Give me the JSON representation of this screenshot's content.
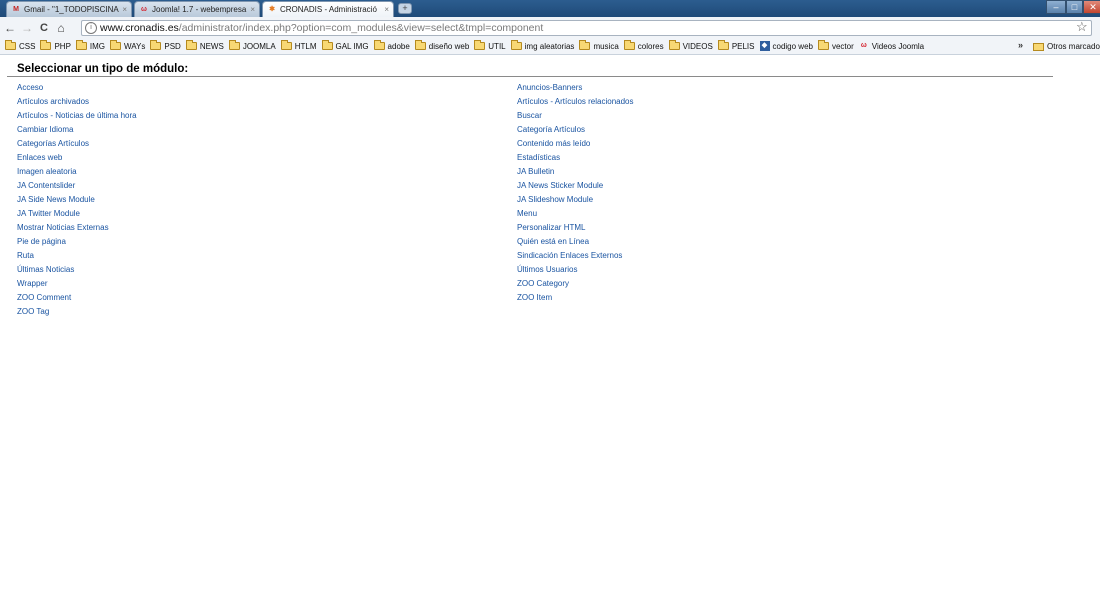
{
  "browser": {
    "tabs": [
      {
        "title": "Gmail - \"1_TODOPISCINA\"",
        "icon": "gmail-icon",
        "active": false
      },
      {
        "title": "Joomla! 1.7 - webempresa",
        "icon": "webempresa-icon",
        "active": false
      },
      {
        "title": "CRONADIS - Administració",
        "icon": "joomla-icon",
        "active": true
      }
    ],
    "newtab_label": "+",
    "tab_close_glyph": "×",
    "window_controls": {
      "minimize": "–",
      "maximize": "□",
      "close": "✕"
    },
    "toolbar": {
      "back": "←",
      "forward": "→",
      "reload": "C",
      "home": "⌂"
    },
    "url": {
      "domain": "www.cronadis.es",
      "path": "/administrator/index.php?option=com_modules&view=select&tmpl=component"
    },
    "star": "☆",
    "bookmarks": [
      {
        "label": "CSS",
        "icon": "folder-icon"
      },
      {
        "label": "PHP",
        "icon": "folder-icon"
      },
      {
        "label": "IMG",
        "icon": "folder-icon"
      },
      {
        "label": "WAYs",
        "icon": "folder-icon"
      },
      {
        "label": "PSD",
        "icon": "folder-icon"
      },
      {
        "label": "NEWS",
        "icon": "folder-icon"
      },
      {
        "label": "JOOMLA",
        "icon": "folder-icon"
      },
      {
        "label": "HTLM",
        "icon": "folder-icon"
      },
      {
        "label": "GAL IMG",
        "icon": "folder-icon"
      },
      {
        "label": "adobe",
        "icon": "folder-icon"
      },
      {
        "label": "diseño web",
        "icon": "folder-icon"
      },
      {
        "label": "UTIL",
        "icon": "folder-icon"
      },
      {
        "label": "img aleatorias",
        "icon": "folder-icon"
      },
      {
        "label": "musica",
        "icon": "folder-icon"
      },
      {
        "label": "colores",
        "icon": "folder-icon"
      },
      {
        "label": "VIDEOS",
        "icon": "folder-icon"
      },
      {
        "label": "PELIS",
        "icon": "folder-icon"
      },
      {
        "label": "codigo web",
        "icon": "codigo-web-icon"
      },
      {
        "label": "vector",
        "icon": "folder-icon"
      },
      {
        "label": "Videos Joomla",
        "icon": "webempresa-icon"
      }
    ],
    "bookmarks_overflow": "»",
    "other_bookmarks": "Otros marcado"
  },
  "page": {
    "title": "Seleccionar un tipo de módulo:",
    "left_modules": [
      "Acceso",
      "Artículos archivados",
      "Artículos - Noticias de última hora",
      "Cambiar Idioma",
      "Categorías Artículos",
      "Enlaces web",
      "Imagen aleatoria",
      "JA Contentslider",
      "JA Side News Module",
      "JA Twitter Module",
      "Mostrar Noticias Externas",
      "Pie de página",
      "Ruta",
      "Últimas Noticias",
      "Wrapper",
      "ZOO Comment",
      "ZOO Tag"
    ],
    "right_modules": [
      "Anuncios-Banners",
      "Artículos - Artículos relacionados",
      "Buscar",
      "Categoría Artículos",
      "Contenido más leído",
      "Estadísticas",
      "JA Bulletin",
      "JA News Sticker Module",
      "JA Slideshow Module",
      "Menu",
      "Personalizar HTML",
      "Quién está en Línea",
      "Sindicación Enlaces Externos",
      "Últimos Usuarios",
      "ZOO Category",
      "ZOO Item"
    ]
  },
  "colors": {
    "link": "#1a54a1",
    "titlebar": "#2c5d8f"
  }
}
